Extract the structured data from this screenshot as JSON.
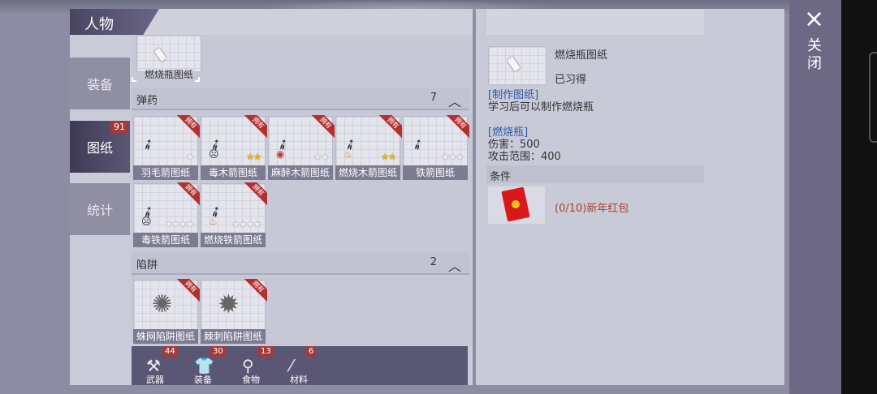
{
  "header": {
    "title": "人物"
  },
  "sidebar": {
    "tabs": [
      {
        "label": "装备"
      },
      {
        "label": "图纸",
        "badge": "91"
      },
      {
        "label": "统计"
      }
    ]
  },
  "selected_card": {
    "name": "燃烧瓶图纸"
  },
  "sections": [
    {
      "label": "弹药",
      "count": "7",
      "cards": [
        {
          "name": "羽毛箭图纸",
          "ribbon": "拥有",
          "stars": "1w"
        },
        {
          "name": "毒木箭图纸",
          "ribbon": "拥有",
          "stars": "2g"
        },
        {
          "name": "麻醉木箭图纸",
          "ribbon": "拥有",
          "stars": "2w"
        },
        {
          "name": "燃烧木箭图纸",
          "ribbon": "拥有",
          "stars": "2g"
        },
        {
          "name": "铁箭图纸",
          "ribbon": "拥有",
          "stars": "3w"
        },
        {
          "name": "毒铁箭图纸",
          "ribbon": "拥有",
          "stars": "4w"
        },
        {
          "name": "燃烧铁箭图纸",
          "ribbon": "拥有",
          "stars": "4w"
        }
      ]
    },
    {
      "label": "陷阱",
      "count": "2",
      "cards": [
        {
          "name": "蛛网陷阱图纸",
          "ribbon": "拥有"
        },
        {
          "name": "棘刺陷阱图纸",
          "ribbon": "拥有"
        }
      ]
    }
  ],
  "bottom_tabs": [
    {
      "label": "武器",
      "count": "44"
    },
    {
      "label": "装备",
      "count": "30"
    },
    {
      "label": "食物",
      "count": "13"
    },
    {
      "label": "材料",
      "count": "6"
    }
  ],
  "detail": {
    "name": "燃烧瓶图纸",
    "status": "已习得",
    "section1_title": "[制作图纸]",
    "section1_text": "学习后可以制作燃烧瓶",
    "section2_title": "[燃烧瓶]",
    "damage": "伤害：500",
    "range": "攻击范围：400",
    "condition_title": "条件",
    "condition_item": "(0/10)新年红包"
  },
  "close": {
    "label": "关闭",
    "icon": "×"
  },
  "colors": {
    "accent": "#5a5774",
    "badge": "#a33a3a",
    "condition": "#a8452b",
    "info_blue": "#2d5aa6"
  }
}
